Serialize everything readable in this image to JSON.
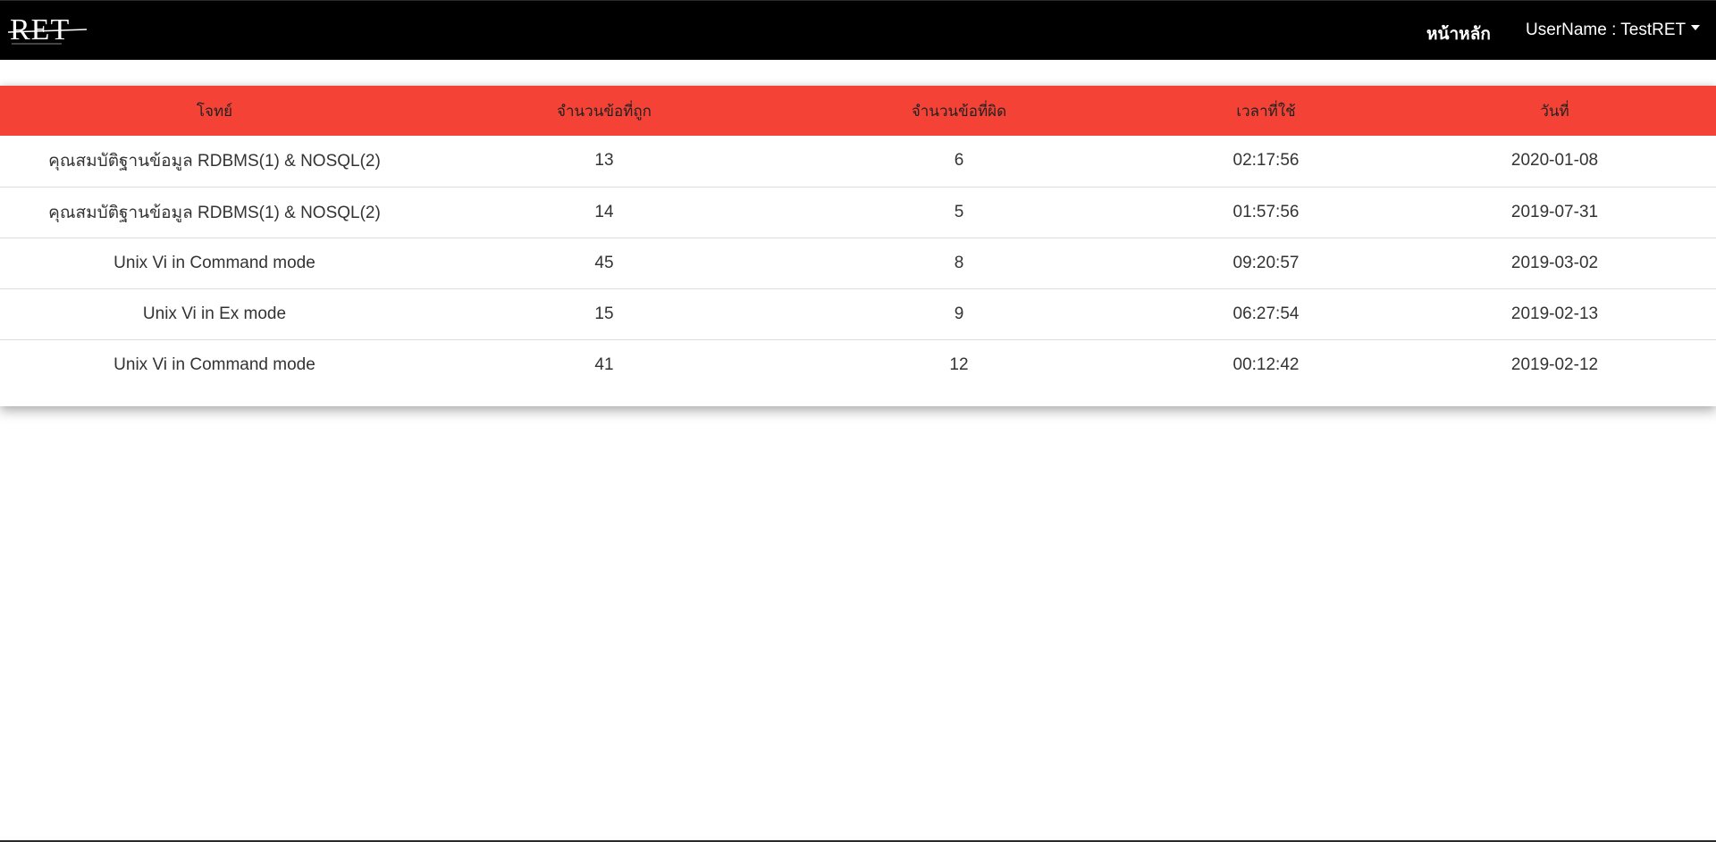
{
  "navbar": {
    "logo_text": "RET",
    "home_label": "หน้าหลัก",
    "user_label": "UserName : TestRET"
  },
  "table": {
    "headers": [
      "โจทย์",
      "จำนวนข้อที่ถูก",
      "จำนวนข้อที่ผิด",
      "เวลาที่ใช้",
      "วันที่"
    ],
    "rows": [
      {
        "problem": "คุณสมบัติฐานข้อมูล RDBMS(1) & NOSQL(2)",
        "correct": "13",
        "wrong": "6",
        "time": "02:17:56",
        "date": "2020-01-08"
      },
      {
        "problem": "คุณสมบัติฐานข้อมูล RDBMS(1) & NOSQL(2)",
        "correct": "14",
        "wrong": "5",
        "time": "01:57:56",
        "date": "2019-07-31"
      },
      {
        "problem": "Unix Vi in Command mode",
        "correct": "45",
        "wrong": "8",
        "time": "09:20:57",
        "date": "2019-03-02"
      },
      {
        "problem": "Unix Vi in Ex mode",
        "correct": "15",
        "wrong": "9",
        "time": "06:27:54",
        "date": "2019-02-13"
      },
      {
        "problem": "Unix Vi in Command mode",
        "correct": "41",
        "wrong": "12",
        "time": "00:12:42",
        "date": "2019-02-12"
      }
    ]
  },
  "colors": {
    "navbar_bg": "#000000",
    "header_bg": "#f44336"
  }
}
